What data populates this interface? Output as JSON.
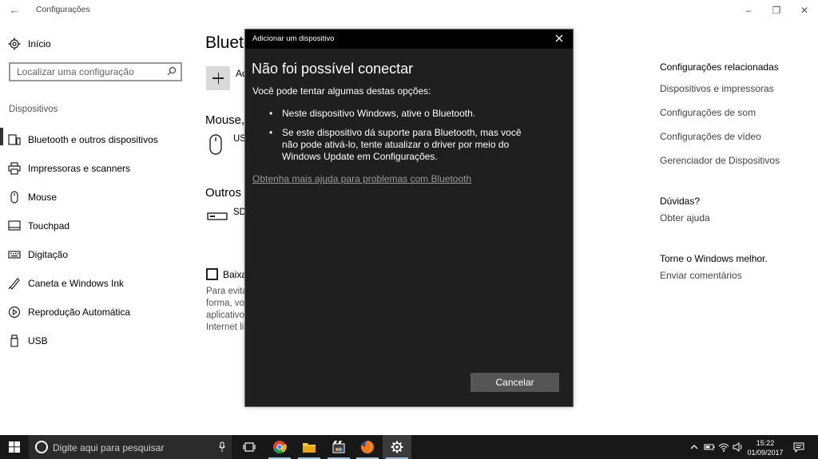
{
  "window": {
    "title": "Configurações"
  },
  "sidebar": {
    "home_label": "Início",
    "search_placeholder": "Localizar uma configuração",
    "section_label": "Dispositivos",
    "items": [
      {
        "label": "Bluetooth e outros dispositivos",
        "icon": "bluetooth-devices-icon",
        "active": true
      },
      {
        "label": "Impressoras e scanners",
        "icon": "printer-icon",
        "active": false
      },
      {
        "label": "Mouse",
        "icon": "mouse-icon",
        "active": false
      },
      {
        "label": "Touchpad",
        "icon": "touchpad-icon",
        "active": false
      },
      {
        "label": "Digitação",
        "icon": "keyboard-icon",
        "active": false
      },
      {
        "label": "Caneta e Windows Ink",
        "icon": "pen-icon",
        "active": false
      },
      {
        "label": "Reprodução Automática",
        "icon": "autoplay-icon",
        "active": false
      },
      {
        "label": "USB",
        "icon": "usb-icon",
        "active": false
      }
    ]
  },
  "main": {
    "title": "Blueto",
    "add_label": "Ad",
    "mouse_heading": "Mouse,",
    "mouse_device": "US",
    "other_heading": "Outros",
    "other_device": "SD",
    "checkbox_label": "Baixa",
    "para_lines": [
      "Para evita",
      "forma, vo",
      "aplicativo",
      "Internet li"
    ]
  },
  "right_column": {
    "related_heading": "Configurações relacionadas",
    "related_links": [
      "Dispositivos e impressoras",
      "Configurações de som",
      "Configurações de vídeo",
      "Gerenciador de Dispositivos"
    ],
    "questions_heading": "Dúvidas?",
    "help_link": "Obter ajuda",
    "improve_heading": "Torne o Windows melhor.",
    "feedback_link": "Enviar comentários"
  },
  "dialog": {
    "title": "Adicionar um dispositivo",
    "heading": "Não foi possível conectar",
    "subtitle": "Você pode tentar algumas destas opções:",
    "bullets": [
      "Neste dispositivo Windows, ative o Bluetooth.",
      "Se este dispositivo dá suporte para Bluetooth, mas você não pode ativá-lo, tente atualizar o driver por meio do Windows Update em Configurações."
    ],
    "help_link": "Obtenha mais ajuda para problemas com Bluetooth",
    "cancel_label": "Cancelar"
  },
  "taskbar": {
    "search_placeholder": "Digite aqui para pesquisar",
    "apps": [
      "task-view-icon",
      "chrome-icon",
      "file-explorer-icon",
      "movie-maker-icon",
      "firefox-icon",
      "settings-icon"
    ],
    "time": "15:22",
    "date": "01/09/2017"
  },
  "colors": {
    "dialog_bg": "#1f1f1f",
    "dialog_titlebar": "#000000",
    "taskbar_bg": "#181818",
    "button_bg": "#555555"
  }
}
